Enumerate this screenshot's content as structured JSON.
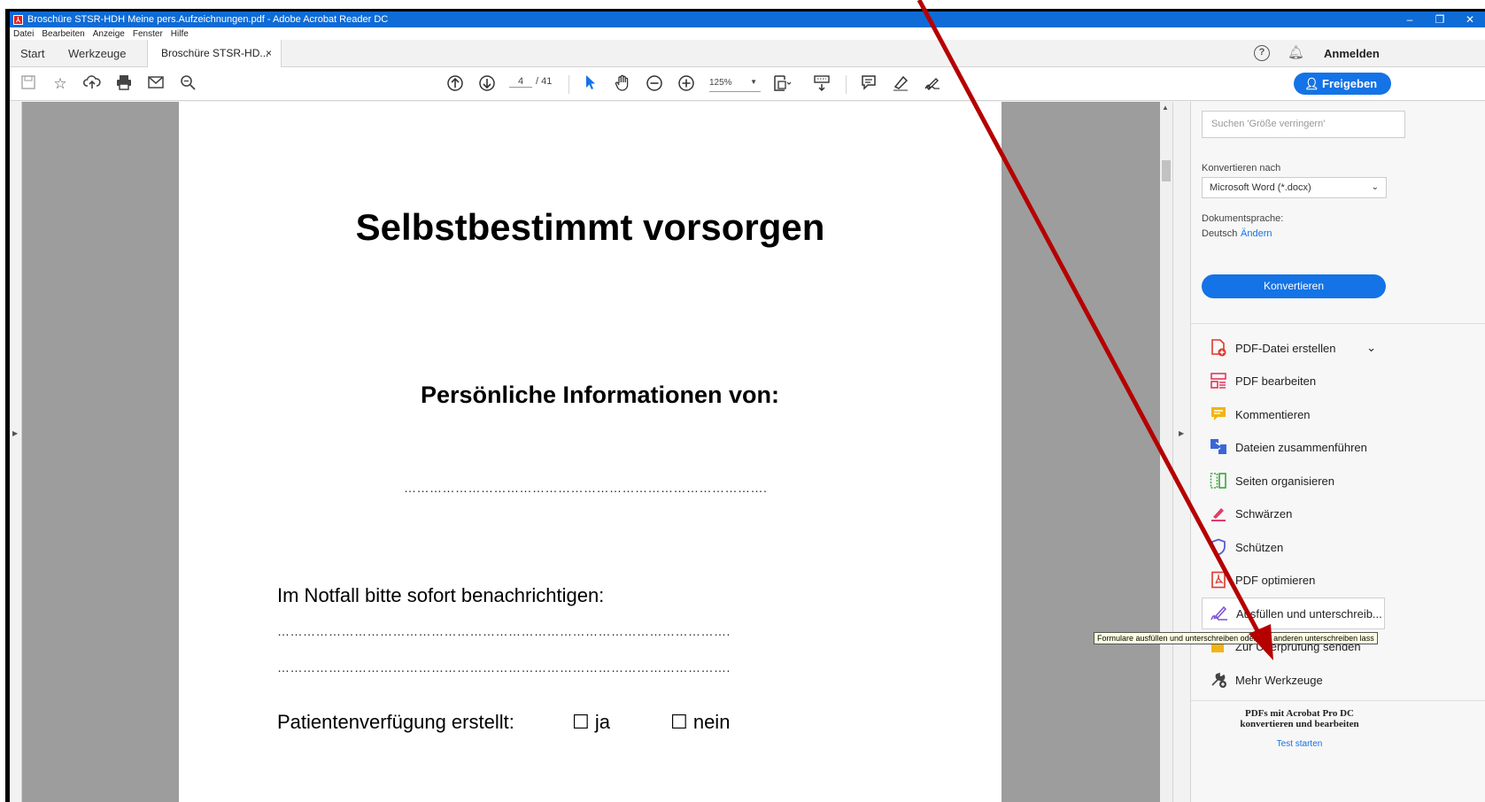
{
  "window": {
    "title": "Broschüre STSR-HDH Meine pers.Aufzeichnungen.pdf - Adobe Acrobat Reader DC",
    "app_icon": "acrobat-icon",
    "minimize": "–",
    "restore": "❐",
    "close": "✕"
  },
  "menu": [
    "Datei",
    "Bearbeiten",
    "Anzeige",
    "Fenster",
    "Hilfe"
  ],
  "tabs": {
    "start": "Start",
    "tools": "Werkzeuge",
    "document": "Broschüre STSR-HD...",
    "document_close": "×",
    "signin": "Anmelden"
  },
  "toolbar": {
    "page_current": "4",
    "page_total": "/ 41",
    "zoom": "125%",
    "share_label": "Freigeben"
  },
  "document": {
    "title": "Selbstbestimmt vorsorgen",
    "subtitle": "Persönliche Informationen von:",
    "dots_name": "………………………………………………………………………….",
    "notfall_label": "Im Notfall bitte sofort benachrichtigen:",
    "dots_line1": "…………………………………………………………………………………………….",
    "dots_line2": "…………………………………………………………………………………………….",
    "patient_label": "Patientenverfügung erstellt:",
    "option_yes": "☐ ja",
    "option_no": "☐ nein"
  },
  "panel": {
    "search_placeholder": "Suchen 'Größe verringern'",
    "convert_to_label": "Konvertieren nach",
    "format_value": "Microsoft Word (*.docx)",
    "language_label": "Dokumentsprache:",
    "language_value": "Deutsch",
    "language_change": "Ändern",
    "convert_button": "Konvertieren",
    "tools": [
      {
        "label": "PDF-Datei erstellen",
        "icon": "create-pdf-icon",
        "color": "#e0372c"
      },
      {
        "label": "PDF bearbeiten",
        "icon": "edit-pdf-icon",
        "color": "#e0375c"
      },
      {
        "label": "Kommentieren",
        "icon": "comment-icon",
        "color": "#f2b414"
      },
      {
        "label": "Dateien zusammenführen",
        "icon": "combine-files-icon",
        "color": "#3a66d8"
      },
      {
        "label": "Seiten organisieren",
        "icon": "organize-pages-icon",
        "color": "#3aa63a"
      },
      {
        "label": "Schwärzen",
        "icon": "redact-icon",
        "color": "#e03c6a"
      },
      {
        "label": "Schützen",
        "icon": "protect-icon",
        "color": "#5b5bd6"
      },
      {
        "label": "PDF optimieren",
        "icon": "optimize-pdf-icon",
        "color": "#e0372c"
      },
      {
        "label": "Ausfüllen und unterschreib...",
        "icon": "fill-sign-icon",
        "color": "#7b4fd6"
      },
      {
        "label": "Zur Überprüfung senden",
        "icon": "send-review-icon",
        "color": "#f2b414"
      },
      {
        "label": "Mehr Werkzeuge",
        "icon": "more-tools-icon",
        "color": "#444444"
      }
    ],
    "tooltip": "Formulare ausfüllen und unterschreiben oder von anderen unterschreiben lass",
    "promo": "PDFs mit Acrobat Pro DC konvertieren und bearbeiten",
    "trial_link": "Test starten"
  },
  "colors": {
    "accent": "#1473e6",
    "arrow": "#b50000"
  }
}
